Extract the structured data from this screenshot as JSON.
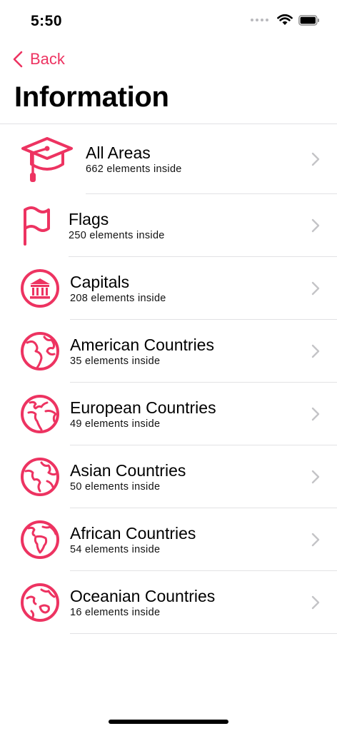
{
  "status_bar": {
    "time": "5:50",
    "icons": [
      "signal-dots-icon",
      "wifi-icon",
      "battery-icon"
    ]
  },
  "nav": {
    "back_label": "Back",
    "back_icon": "chevron-left-icon"
  },
  "page": {
    "title": "Information"
  },
  "colors": {
    "accent": "#ed3361",
    "separator": "#e2e2e4",
    "chevron": "#c4c4c7"
  },
  "list": {
    "items": [
      {
        "title": "All Areas",
        "subtitle": "662 elements inside",
        "icon": "graduation-cap-icon"
      },
      {
        "title": "Flags",
        "subtitle": "250 elements inside",
        "icon": "flag-icon"
      },
      {
        "title": "Capitals",
        "subtitle": "208 elements inside",
        "icon": "capital-building-icon"
      },
      {
        "title": "American Countries",
        "subtitle": "35 elements inside",
        "icon": "globe-americas-icon"
      },
      {
        "title": "European Countries",
        "subtitle": "49 elements inside",
        "icon": "globe-europe-icon"
      },
      {
        "title": "Asian Countries",
        "subtitle": "50 elements inside",
        "icon": "globe-asia-icon"
      },
      {
        "title": "African Countries",
        "subtitle": "54 elements inside",
        "icon": "globe-africa-icon"
      },
      {
        "title": "Oceanian Countries",
        "subtitle": "16 elements inside",
        "icon": "globe-oceania-icon"
      }
    ]
  }
}
